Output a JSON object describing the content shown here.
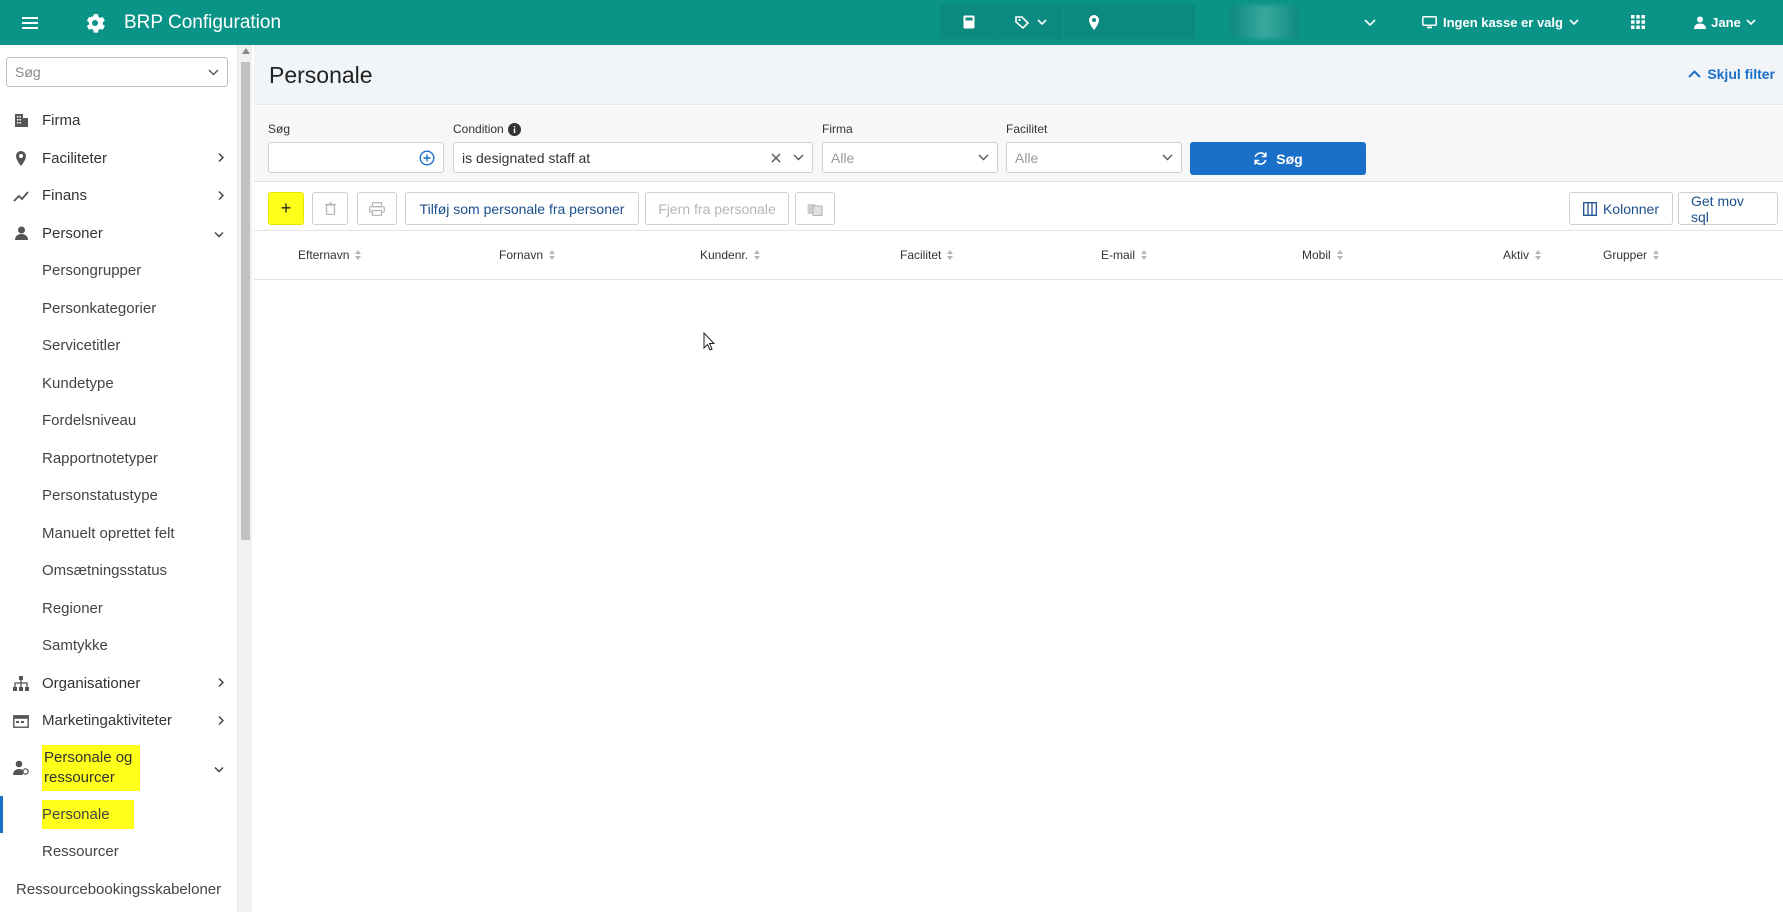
{
  "app": {
    "title": "BRP Configuration",
    "register_label": "Ingen kasse er valg",
    "user_label": "Jane"
  },
  "sidebar": {
    "search_placeholder": "Søg",
    "items": [
      {
        "label": "Firma",
        "icon": "building-icon"
      },
      {
        "label": "Faciliteter",
        "icon": "location-pin-icon"
      },
      {
        "label": "Finans",
        "icon": "trend-chart-icon"
      },
      {
        "label": "Personer",
        "icon": "person-icon"
      },
      {
        "label": "Organisationer",
        "icon": "org-chart-icon"
      },
      {
        "label": "Marketingaktiviteter",
        "icon": "calendar-icon"
      },
      {
        "label": "Personale og ressourcer",
        "icon": "staff-icon"
      }
    ],
    "personer_sub": [
      "Persongrupper",
      "Personkategorier",
      "Servicetitler",
      "Kundetype",
      "Fordelsniveau",
      "Rapportnotetyper",
      "Personstatustype",
      "Manuelt oprettet felt",
      "Omsætningsstatus",
      "Regioner",
      "Samtykke"
    ],
    "personale_sub": [
      "Personale",
      "Ressourcer"
    ],
    "last_item": "Ressourcebookingsskabeloner"
  },
  "page": {
    "title": "Personale",
    "hide_filter": "Skjul filter"
  },
  "filters": {
    "search_label": "Søg",
    "condition_label": "Condition",
    "condition_value": "is designated staff at",
    "firma_label": "Firma",
    "firma_value": "Alle",
    "facilitet_label": "Facilitet",
    "facilitet_value": "Alle",
    "search_button": "Søg"
  },
  "toolbar": {
    "add_label": "+",
    "add_from_persons": "Tilføj som personale fra personer",
    "remove_from_staff": "Fjern fra personale",
    "columns": "Kolonner",
    "get_sql": "Get mov sql"
  },
  "table": {
    "columns": [
      "Efternavn",
      "Fornavn",
      "Kundenr.",
      "Facilitet",
      "E-mail",
      "Mobil",
      "Aktiv",
      "Grupper"
    ],
    "rows": []
  },
  "colors": {
    "topbar": "#0a9488",
    "accent": "#1a6fc9",
    "highlight": "#ffff1a"
  }
}
